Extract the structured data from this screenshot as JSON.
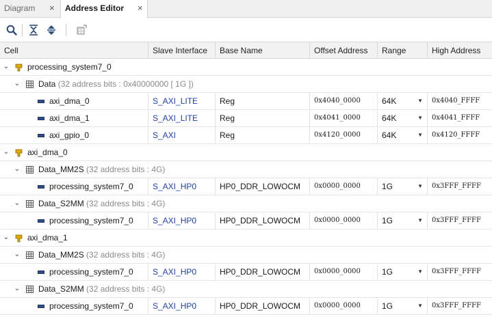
{
  "tabs": [
    {
      "label": "Diagram",
      "close": "×"
    },
    {
      "label": "Address Editor",
      "close": "×"
    }
  ],
  "toolbar": {
    "icons": [
      "search-icon",
      "collapse-all-icon",
      "expand-all-icon",
      "auto-assign-icon"
    ]
  },
  "columns": {
    "cell": "Cell",
    "slave_interface": "Slave Interface",
    "base_name": "Base Name",
    "offset_address": "Offset Address",
    "range": "Range",
    "high_address": "High Address"
  },
  "rows": [
    {
      "kind": "master",
      "level": 0,
      "name": "processing_system7_0"
    },
    {
      "kind": "space",
      "level": 1,
      "name": "Data",
      "info": "(32 address bits : 0x40000000 [ 1G ])"
    },
    {
      "kind": "leaf",
      "level": 2,
      "name": "axi_dma_0",
      "slave": "S_AXI_LITE",
      "base": "Reg",
      "offset": "0x4040_0000",
      "range": "64K",
      "high": "0x4040_FFFF"
    },
    {
      "kind": "leaf",
      "level": 2,
      "name": "axi_dma_1",
      "slave": "S_AXI_LITE",
      "base": "Reg",
      "offset": "0x4041_0000",
      "range": "64K",
      "high": "0x4041_FFFF"
    },
    {
      "kind": "leaf",
      "level": 2,
      "name": "axi_gpio_0",
      "slave": "S_AXI",
      "base": "Reg",
      "offset": "0x4120_0000",
      "range": "64K",
      "high": "0x4120_FFFF"
    },
    {
      "kind": "master",
      "level": 0,
      "name": "axi_dma_0"
    },
    {
      "kind": "space",
      "level": 1,
      "name": "Data_MM2S",
      "info": "(32 address bits : 4G)"
    },
    {
      "kind": "leaf",
      "level": 2,
      "name": "processing_system7_0",
      "slave": "S_AXI_HP0",
      "base": "HP0_DDR_LOWOCM",
      "offset": "0x0000_0000",
      "range": "1G",
      "high": "0x3FFF_FFFF"
    },
    {
      "kind": "space",
      "level": 1,
      "name": "Data_S2MM",
      "info": "(32 address bits : 4G)"
    },
    {
      "kind": "leaf",
      "level": 2,
      "name": "processing_system7_0",
      "slave": "S_AXI_HP0",
      "base": "HP0_DDR_LOWOCM",
      "offset": "0x0000_0000",
      "range": "1G",
      "high": "0x3FFF_FFFF"
    },
    {
      "kind": "master",
      "level": 0,
      "name": "axi_dma_1"
    },
    {
      "kind": "space",
      "level": 1,
      "name": "Data_MM2S",
      "info": "(32 address bits : 4G)"
    },
    {
      "kind": "leaf",
      "level": 2,
      "name": "processing_system7_0",
      "slave": "S_AXI_HP0",
      "base": "HP0_DDR_LOWOCM",
      "offset": "0x0000_0000",
      "range": "1G",
      "high": "0x3FFF_FFFF"
    },
    {
      "kind": "space",
      "level": 1,
      "name": "Data_S2MM",
      "info": "(32 address bits : 4G)"
    },
    {
      "kind": "leaf",
      "level": 2,
      "name": "processing_system7_0",
      "slave": "S_AXI_HP0",
      "base": "HP0_DDR_LOWOCM",
      "offset": "0x0000_0000",
      "range": "1G",
      "high": "0x3FFF_FFFF"
    }
  ],
  "colors": {
    "link": "#1f3fb5",
    "info": "#8a8a8a",
    "cpu_icon": "#e0a800"
  }
}
